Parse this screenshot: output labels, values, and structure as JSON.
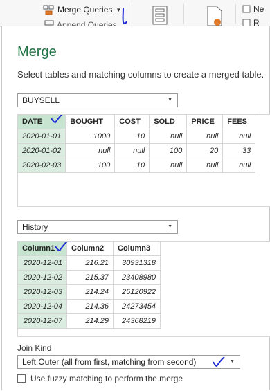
{
  "ribbon": {
    "merge_queries_label": "Merge Queries",
    "append_queries_label": "Append Queries",
    "right_label": "Ne",
    "right_label2": "R"
  },
  "dialog": {
    "title": "Merge",
    "subtitle": "Select tables and matching columns to create a merged table.",
    "table1": {
      "selected": "BUYSELL",
      "columns": [
        "DATE",
        "BOUGHT",
        "COST",
        "SOLD",
        "PRICE",
        "FEES"
      ],
      "rows": [
        [
          "2020-01-01",
          "1000",
          "10",
          "null",
          "null",
          "null"
        ],
        [
          "2020-01-02",
          "null",
          "null",
          "100",
          "20",
          "33"
        ],
        [
          "2020-02-03",
          "100",
          "10",
          "null",
          "null",
          "null"
        ]
      ]
    },
    "table2": {
      "selected": "History",
      "columns": [
        "Column1",
        "Column2",
        "Column3"
      ],
      "rows": [
        [
          "2020-12-01",
          "216.21",
          "30931318"
        ],
        [
          "2020-12-02",
          "215.37",
          "23408980"
        ],
        [
          "2020-12-03",
          "214.24",
          "25120922"
        ],
        [
          "2020-12-04",
          "214.36",
          "24273454"
        ],
        [
          "2020-12-07",
          "214.29",
          "24368219"
        ]
      ]
    },
    "join_kind_label": "Join Kind",
    "join_kind_value": "Left Outer (all from first, matching from second)",
    "fuzzy_label": "Use fuzzy matching to perform the merge"
  },
  "colors": {
    "title": "#217346",
    "selected_column": "#d9ecdf",
    "annotation": "#1f2bd6"
  }
}
